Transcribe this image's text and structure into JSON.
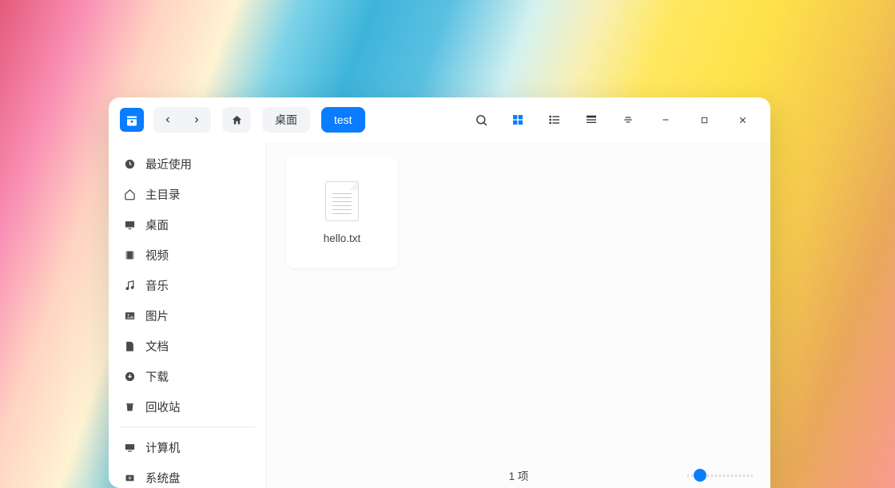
{
  "breadcrumb": {
    "parent": "桌面",
    "current": "test"
  },
  "sidebar": {
    "items": [
      {
        "id": "recent",
        "label": "最近使用",
        "icon": "clock"
      },
      {
        "id": "home",
        "label": "主目录",
        "icon": "home"
      },
      {
        "id": "desktop",
        "label": "桌面",
        "icon": "desktop"
      },
      {
        "id": "videos",
        "label": "视频",
        "icon": "film"
      },
      {
        "id": "music",
        "label": "音乐",
        "icon": "music"
      },
      {
        "id": "pictures",
        "label": "图片",
        "icon": "image"
      },
      {
        "id": "documents",
        "label": "文档",
        "icon": "file"
      },
      {
        "id": "downloads",
        "label": "下载",
        "icon": "download"
      },
      {
        "id": "trash",
        "label": "回收站",
        "icon": "trash"
      }
    ],
    "devices": [
      {
        "id": "computer",
        "label": "计算机",
        "icon": "computer"
      },
      {
        "id": "sysdisk",
        "label": "系统盘",
        "icon": "disk"
      }
    ]
  },
  "files": [
    {
      "name": "hello.txt",
      "type": "text"
    }
  ],
  "status": {
    "count_text": "1 项"
  },
  "view": {
    "mode": "grid"
  }
}
